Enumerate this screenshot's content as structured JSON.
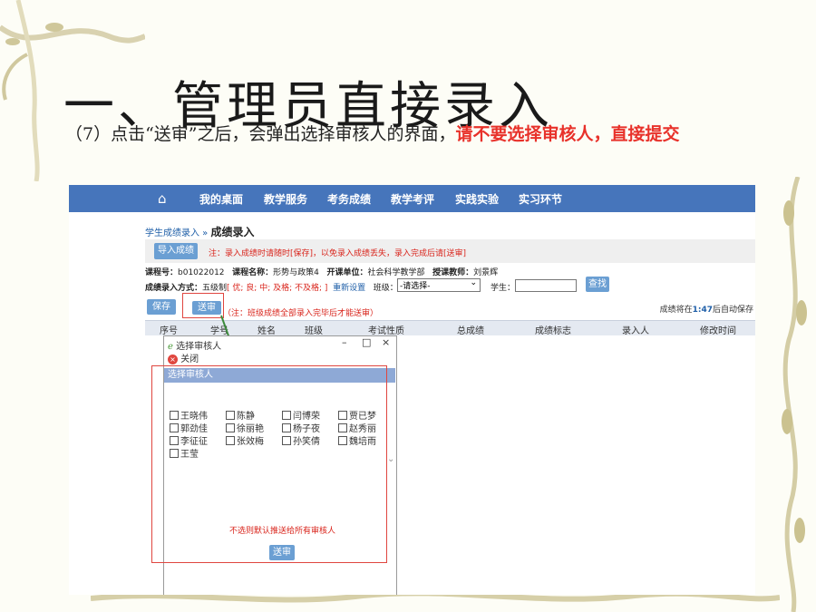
{
  "slide": {
    "title": "一、管理员直接录入",
    "instruction_plain": "（7）点击“送审”之后，会弹出选择审核人的界面，",
    "instruction_highlight": "请不要选择审核人，直接提交"
  },
  "nav": {
    "items": [
      "我的桌面",
      "教学服务",
      "考务成绩",
      "教学考评",
      "实践实验",
      "实习环节"
    ]
  },
  "breadcrumb": {
    "parent": "学生成绩录入",
    "sep": " » ",
    "current": "成绩录入"
  },
  "toolbar": {
    "import_label": "导入成绩",
    "note": "注：录入成绩时请随时[保存]，以免录入成绩丢失，录入完成后请[送审]"
  },
  "course": {
    "code_label": "课程号：",
    "code": "b01022012",
    "name_label": "课程名称：",
    "name": "形势与政策4",
    "dept_label": "开课单位：",
    "dept": "社会科学教学部",
    "teacher_label": "授课教师：",
    "teacher": "刘景辉"
  },
  "mode": {
    "label": "成绩录入方式：",
    "value": "五级制",
    "options": "[ 优; 良; 中; 及格; 不及格; ]",
    "reset": "重新设置",
    "class_label": "班级：",
    "class_select": "-请选择-",
    "student_label": "学生：",
    "search_label": "查找"
  },
  "actions": {
    "save_label": "保存",
    "submit_label": "送审",
    "hint": "（注：班级成绩全部录入完毕后才能送审）",
    "autosave_pre": "成绩将在",
    "autosave_time": "1:47",
    "autosave_post": "后自动保存"
  },
  "table": {
    "headers": [
      "序号",
      "学号",
      "姓名",
      "班级",
      "考试性质",
      "总成绩",
      "成绩标志",
      "录入人",
      "修改时间"
    ]
  },
  "dialog": {
    "title": "选择审核人",
    "close_label": "关闭",
    "section": "选择审核人",
    "reviewers": [
      "王晓伟",
      "陈静",
      "闫博荣",
      "贾已梦",
      "郭劲佳",
      "徐丽艳",
      "杨子夜",
      "赵秀丽",
      "李征征",
      "张效梅",
      "孙笑倩",
      "魏培雨",
      "王莹"
    ],
    "note": "不选则默认推送给所有审核人",
    "submit_label": "送审"
  },
  "icons": [
    "home-icon",
    "browser-icon",
    "close-circle-icon",
    "minimize-icon",
    "maximize-icon",
    "close-icon",
    "chevron-down-icon"
  ],
  "colors": {
    "nav": "#4675bb",
    "accent_red": "#e8312a",
    "button": "#6b9fd3",
    "dialog_header": "#8ea9d6"
  }
}
